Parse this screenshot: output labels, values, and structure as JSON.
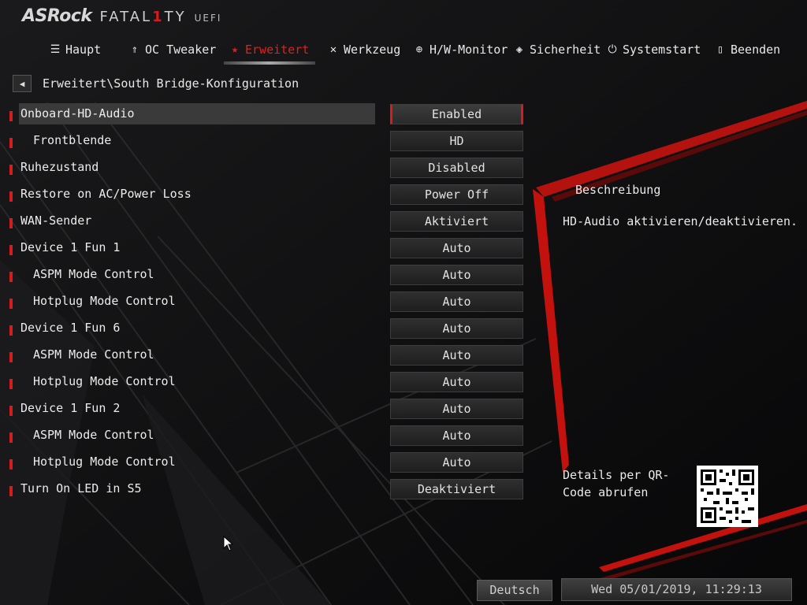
{
  "logo": {
    "brand": "ASRock",
    "series_a": "FATAL",
    "series_one": "1",
    "series_b": "TY",
    "suffix": "UEFI"
  },
  "nav": [
    {
      "label": "Haupt",
      "icon": "list-icon"
    },
    {
      "label": "OC Tweaker",
      "icon": "rocket-icon"
    },
    {
      "label": "Erweitert",
      "icon": "star-icon",
      "active": true
    },
    {
      "label": "Werkzeug",
      "icon": "tools-icon"
    },
    {
      "label": "H/W-Monitor",
      "icon": "crosshair-icon"
    },
    {
      "label": "Sicherheit",
      "icon": "shield-icon"
    },
    {
      "label": "Systemstart",
      "icon": "power-icon"
    },
    {
      "label": "Beenden",
      "icon": "exit-door-icon"
    }
  ],
  "breadcrumb": "Erweitert\\South Bridge-Konfiguration",
  "settings": [
    {
      "label": "Onboard-HD-Audio",
      "value": "Enabled"
    },
    {
      "label": "Frontblende",
      "value": "HD"
    },
    {
      "label": "Ruhezustand",
      "value": "Disabled"
    },
    {
      "label": "Restore on AC/Power Loss",
      "value": "Power Off"
    },
    {
      "label": "WAN-Sender",
      "value": "Aktiviert"
    },
    {
      "label": "Device 1 Fun 1",
      "value": "Auto"
    },
    {
      "label": "ASPM Mode Control",
      "value": "Auto"
    },
    {
      "label": "Hotplug Mode Control",
      "value": "Auto"
    },
    {
      "label": "Device 1 Fun 6",
      "value": "Auto"
    },
    {
      "label": "ASPM Mode Control",
      "value": "Auto"
    },
    {
      "label": "Hotplug Mode Control",
      "value": "Auto"
    },
    {
      "label": "Device 1 Fun 2",
      "value": "Auto"
    },
    {
      "label": "ASPM Mode Control",
      "value": "Auto"
    },
    {
      "label": "Hotplug Mode Control",
      "value": "Auto"
    },
    {
      "label": "Turn On LED in S5",
      "value": "Deaktiviert"
    }
  ],
  "description": {
    "title": "Beschreibung",
    "text": "HD-Audio aktivieren/deaktivieren."
  },
  "qr_hint": "Details per QR-Code abrufen",
  "footer": {
    "language": "Deutsch",
    "datetime": "Wed 05/01/2019, 11:29:13"
  },
  "colors": {
    "accent": "#d81b1b",
    "background": "#0b0b0c",
    "text": "#e6e6e6"
  }
}
